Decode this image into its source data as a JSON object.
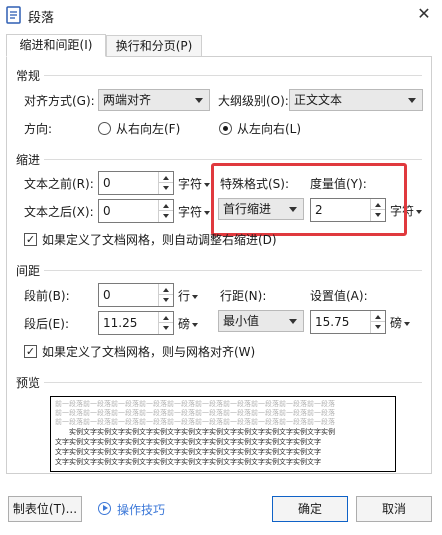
{
  "window": {
    "title": "段落",
    "close_glyph": "✕",
    "app_icon": "document-paragraph-icon"
  },
  "tabs": [
    {
      "label": "缩进和间距(I)",
      "active": true
    },
    {
      "label": "换行和分页(P)",
      "active": false
    }
  ],
  "general": {
    "title": "常规",
    "align_label": "对齐方式(G):",
    "align_value": "两端对齐",
    "outline_label": "大纲级别(O):",
    "outline_value": "正文文本",
    "direction_label": "方向:",
    "direction_options": [
      {
        "label": "从右向左(F)",
        "selected": false
      },
      {
        "label": "从左向右(L)",
        "selected": true
      }
    ]
  },
  "indent": {
    "title": "缩进",
    "before_label": "文本之前(R):",
    "before_value": "0",
    "before_unit": "字符",
    "after_label": "文本之后(X):",
    "after_value": "0",
    "after_unit": "字符",
    "special_label": "特殊格式(S):",
    "special_value": "首行缩进",
    "measure_label": "度量值(Y):",
    "measure_value": "2",
    "measure_unit": "字符",
    "grid_check_label": "如果定义了文档网格，则自动调整右缩进(D)",
    "grid_checked": true,
    "highlight_color": "#e0393e"
  },
  "spacing": {
    "title": "间距",
    "before_label": "段前(B):",
    "before_value": "0",
    "before_unit": "行",
    "after_label": "段后(E):",
    "after_value": "11.25",
    "after_unit": "磅",
    "line_label": "行距(N):",
    "line_value": "最小值",
    "setting_label": "设置值(A):",
    "setting_value": "15.75",
    "setting_unit": "磅",
    "grid_check_label": "如果定义了文档网格，则与网格对齐(W)",
    "grid_checked": true
  },
  "preview": {
    "title": "预览",
    "prev_text": "前一段落前一段落前一段落前一段落前一段落前一段落前一段落前一段落前一段落前一段落",
    "sample_text_1": "实例文字实例文字实例文字实例文字实例文字实例文字实例文字实例文字实例文字实例",
    "sample_text_2": "文字实例文字实例文字实例文字实例文字实例文字实例文字实例文字实例文字实例文字",
    "sample_text_3": "文字实例文字实例文字实例文字实例文字实例文字实例文字实例文字实例文字实例文字"
  },
  "footer": {
    "tabs_button": "制表位(T)...",
    "tips_label": "操作技巧",
    "ok_button": "确定",
    "cancel_button": "取消",
    "accent_color": "#3c78d8"
  }
}
